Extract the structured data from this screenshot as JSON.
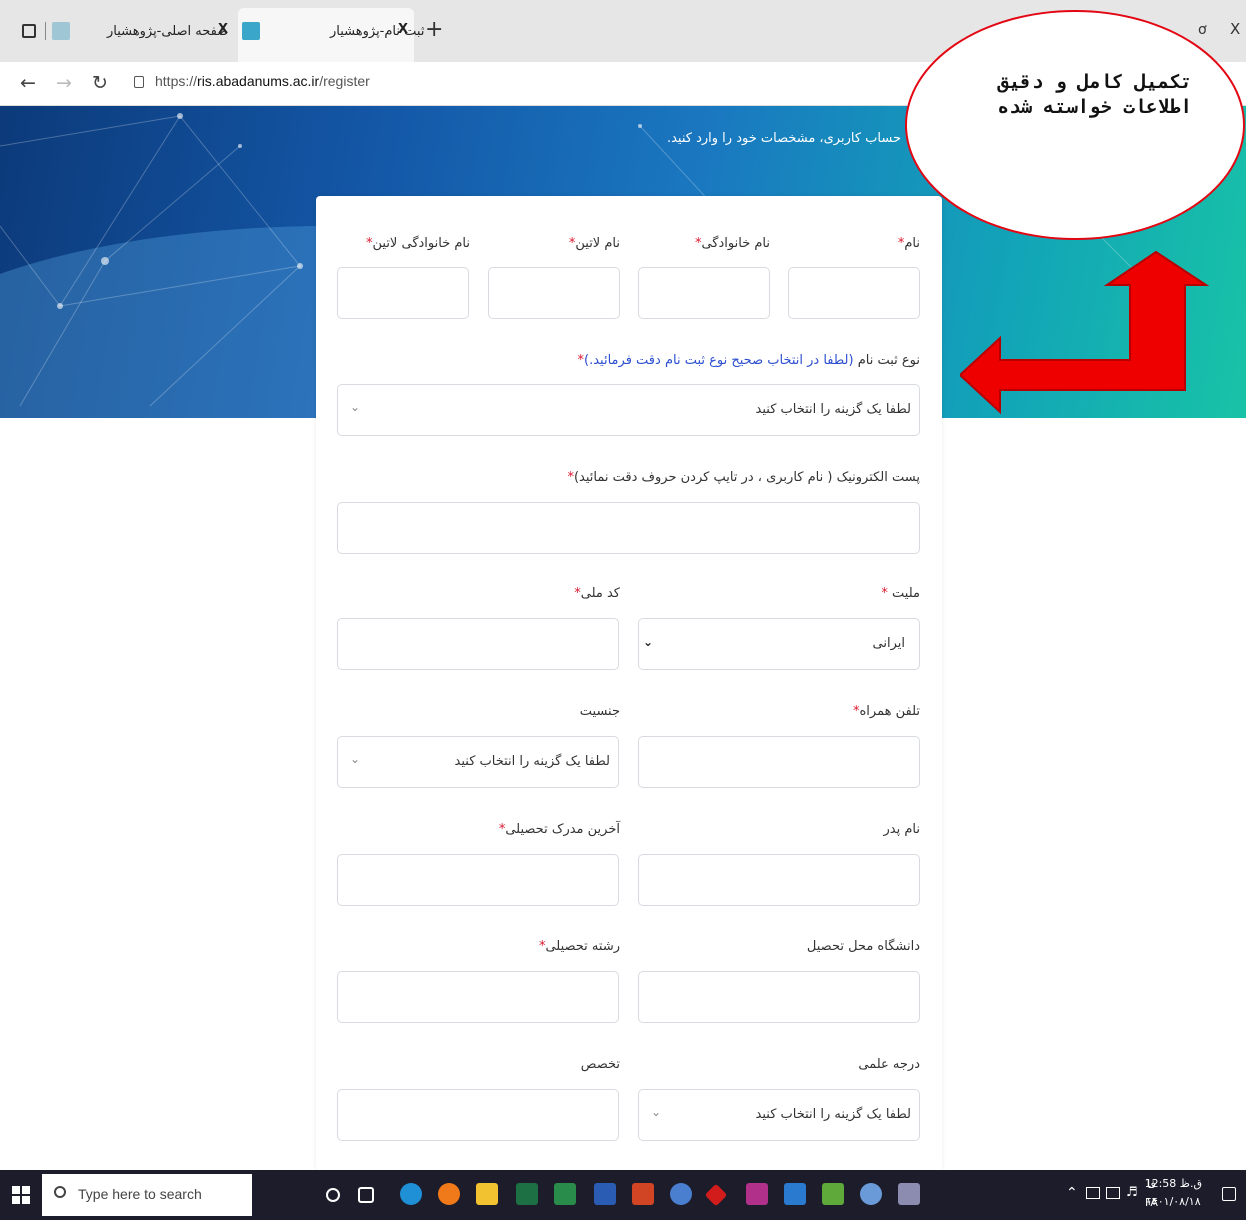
{
  "browser": {
    "tabs": [
      {
        "title": "صفحه اصلی-پژوهشیار",
        "close": "X"
      },
      {
        "title": "ثبت نام-پژوهشیار",
        "close": "X"
      }
    ],
    "new_tab": "+",
    "window_controls": {
      "restore": "ơ",
      "close": "X"
    },
    "url_prefix": "https://",
    "url_domain": "ris.abadanums.ac.ir",
    "url_path": "/register"
  },
  "hero": {
    "text": "حساب کاربری، مشخصات خود را وارد کنید."
  },
  "form": {
    "first_name_label": "نام",
    "last_name_label": "نام خانوادگی",
    "latin_name_label": "نام لاتین",
    "latin_last_name_label": "نام خانوادگی لاتین",
    "reg_type_label": "نوع ثبت نام",
    "reg_type_hint": "(لطفا در انتخاب صحیح نوع ثبت نام دقت فرمائید.)",
    "reg_type_value": "لطفا یک گزینه را انتخاب کنید",
    "email_label": "پست الکترونیک ( نام کاربری ، در تایپ کردن حروف دقت نمائید)",
    "nationality_label": "ملیت",
    "nationality_value": "ایرانی",
    "national_code_label": "کد ملی",
    "mobile_label": "تلفن همراه",
    "gender_label": "جنسیت",
    "gender_value": "لطفا یک گزینه را انتخاب کنید",
    "father_name_label": "نام پدر",
    "last_degree_label": "آخرین مدرک تحصیلی",
    "university_label": "دانشگاه محل تحصیل",
    "field_label": "رشته تحصیلی",
    "academic_rank_label": "درجه علمی",
    "academic_rank_value": "لطفا یک گزینه را انتخاب کنید",
    "specialty_label": "تخصص",
    "required_mark": "*"
  },
  "callout": {
    "text": "تکمیل کامل و دقیق اطلاعات خواسته شده",
    "border_color": "#e30613",
    "arrow_color": "#ee0000"
  },
  "taskbar": {
    "search_placeholder": "Type here to search",
    "clock_time": "12:58 ق.ظ",
    "clock_date": "۱۴۰۱/۰۸/۱۸",
    "lang": "FA",
    "lang_small": "فا"
  }
}
